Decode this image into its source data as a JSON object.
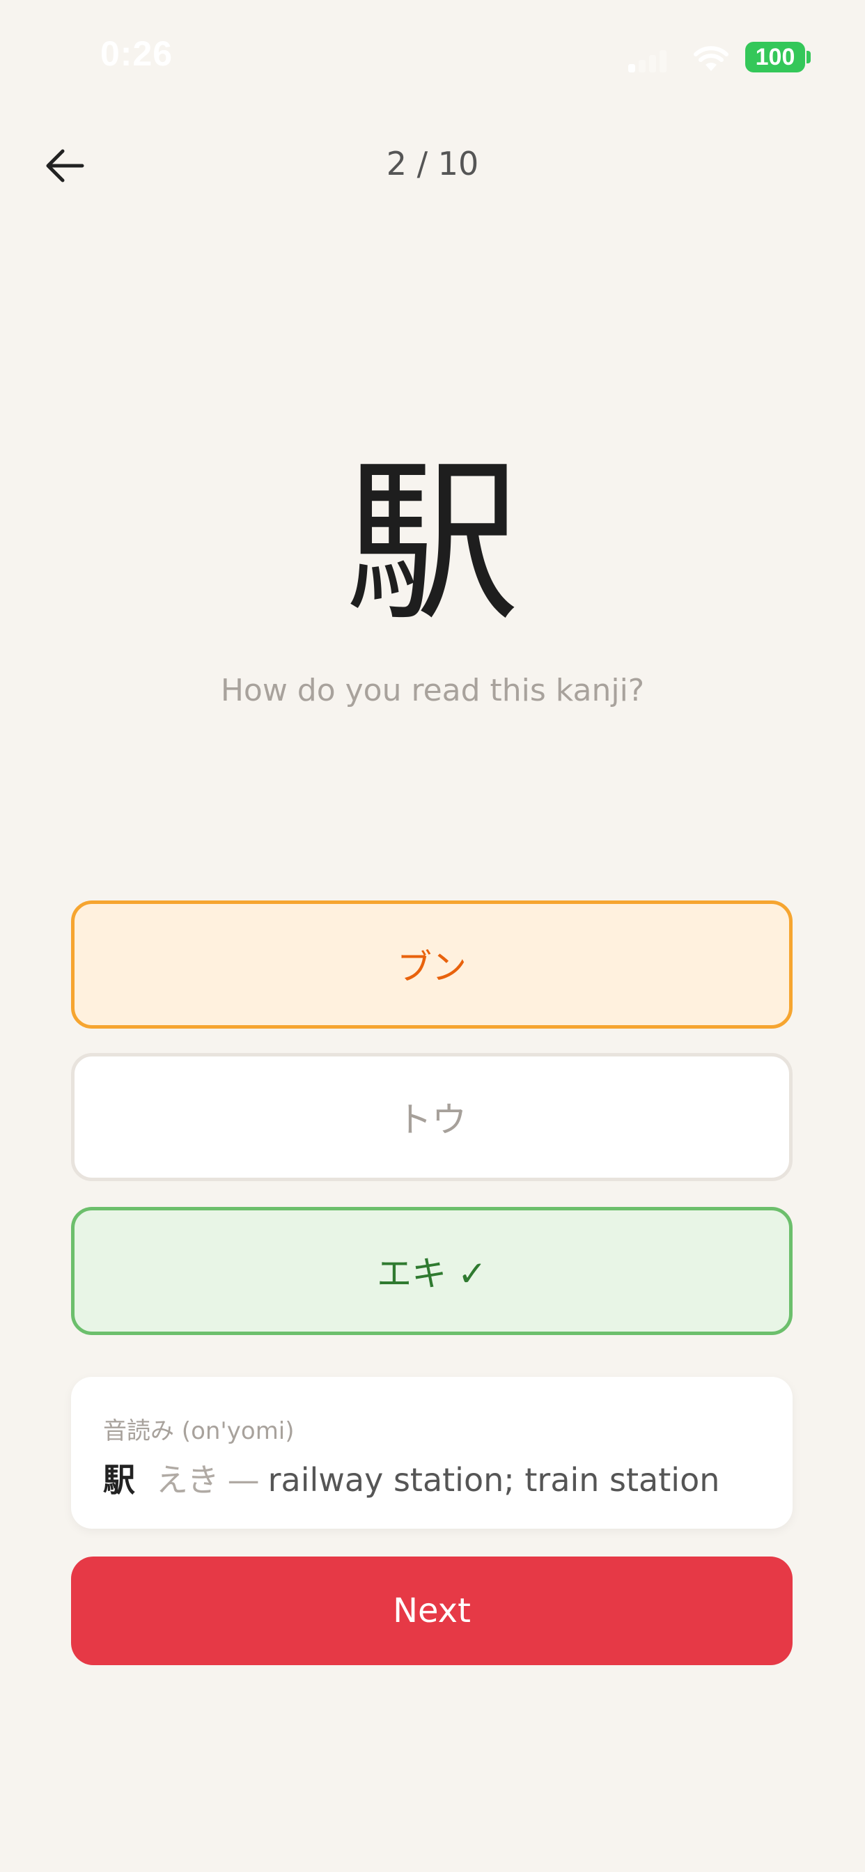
{
  "status_bar": {
    "time": "0:26",
    "battery": "100",
    "battery_color": "#34c759"
  },
  "header": {
    "back_icon": "arrow-left-icon",
    "progress": "2 / 10"
  },
  "quiz": {
    "kanji": "駅",
    "question": "How do you read this kanji?",
    "options": [
      {
        "label": "ブン",
        "state": "selected-wrong",
        "color": "#e8620c"
      },
      {
        "label": "トウ",
        "state": "neutral",
        "color": "#a6a09a"
      },
      {
        "label": "エキ ✓",
        "state": "correct",
        "color": "#2f7a30"
      }
    ]
  },
  "info": {
    "label": "音読み (on'yomi)",
    "kanji": "駅",
    "reading": "えき",
    "dash": "—",
    "meaning": "railway station; train station"
  },
  "next_button": {
    "label": "Next",
    "color": "#e63946"
  }
}
